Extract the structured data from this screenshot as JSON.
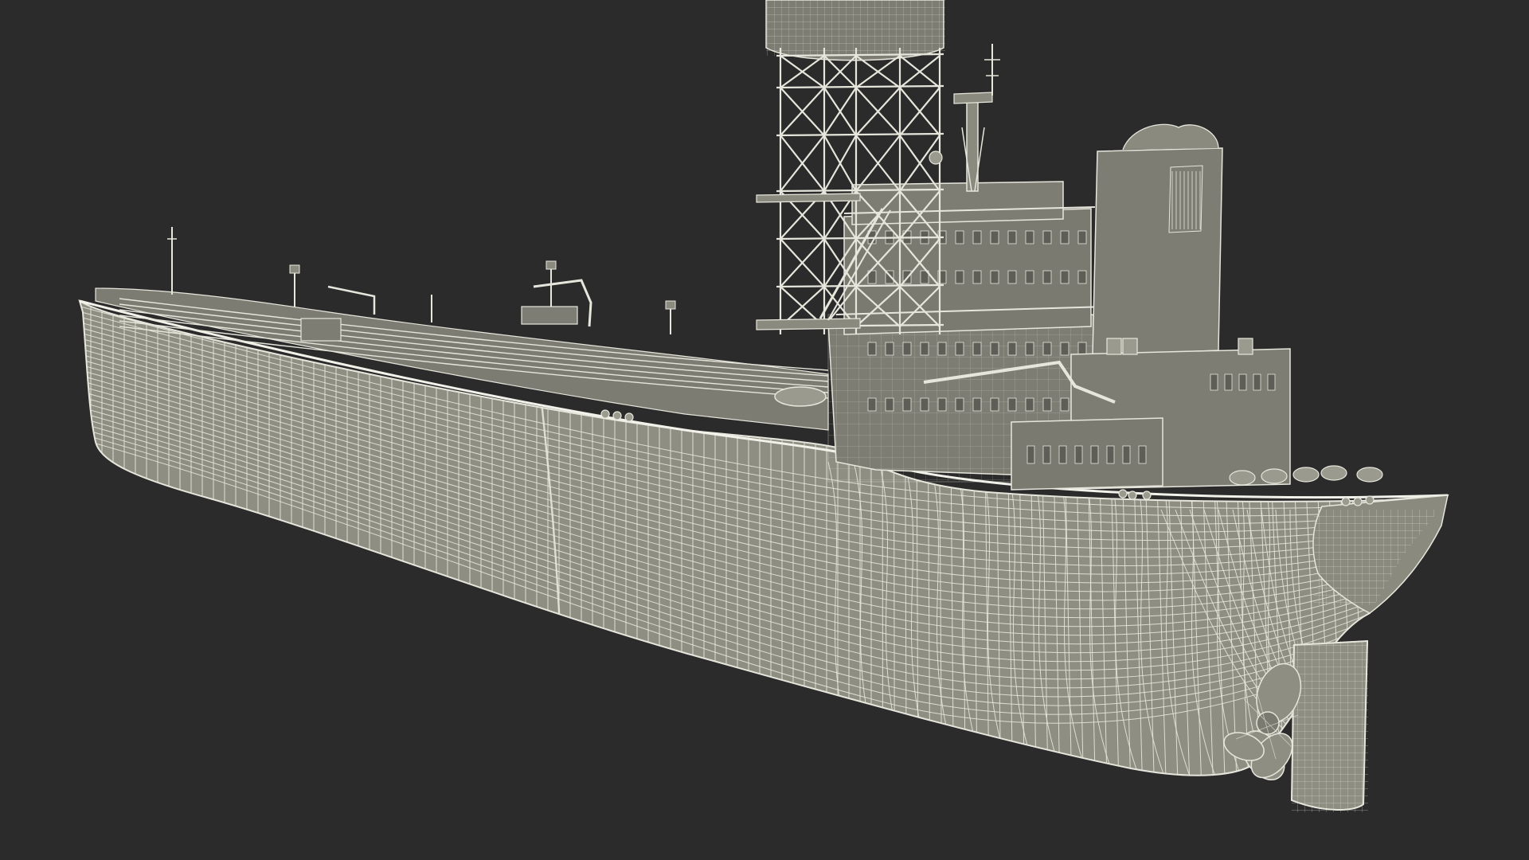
{
  "scene": {
    "background_color": "#2b2b2b",
    "hull_color": "#8e8e82",
    "hull_shadow_color": "#6f6f65",
    "superstructure_color": "#7d7d73",
    "wire_color": "#e6e6dc",
    "subject": "oil-tanker-wireframe-render"
  }
}
